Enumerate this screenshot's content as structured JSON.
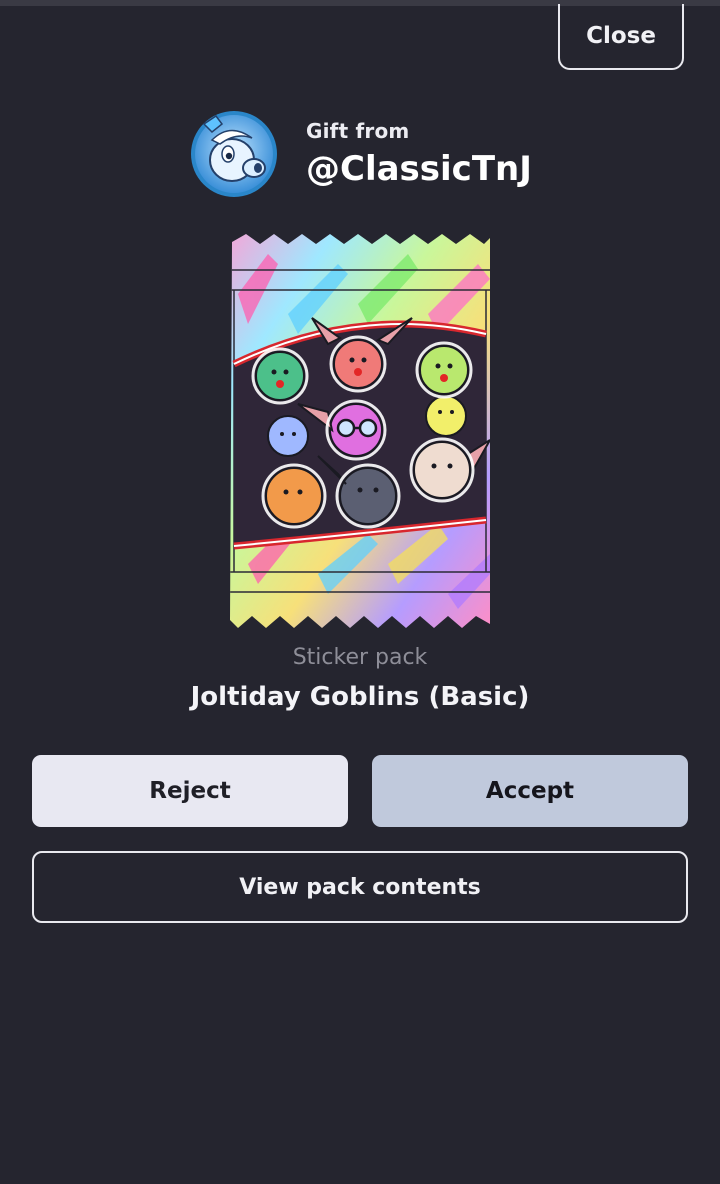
{
  "close_button": {
    "label": "Close"
  },
  "gift": {
    "label": "Gift from",
    "username": "@ClassicTnJ"
  },
  "pack": {
    "type_label": "Sticker pack",
    "name": "Joltiday Goblins (Basic)"
  },
  "actions": {
    "reject_label": "Reject",
    "accept_label": "Accept",
    "view_contents_label": "View pack contents"
  },
  "colors": {
    "background": "#25252f",
    "reject_bg": "#e8e8f2",
    "accept_bg": "#c0c9dc",
    "muted_text": "#8e8e98"
  }
}
